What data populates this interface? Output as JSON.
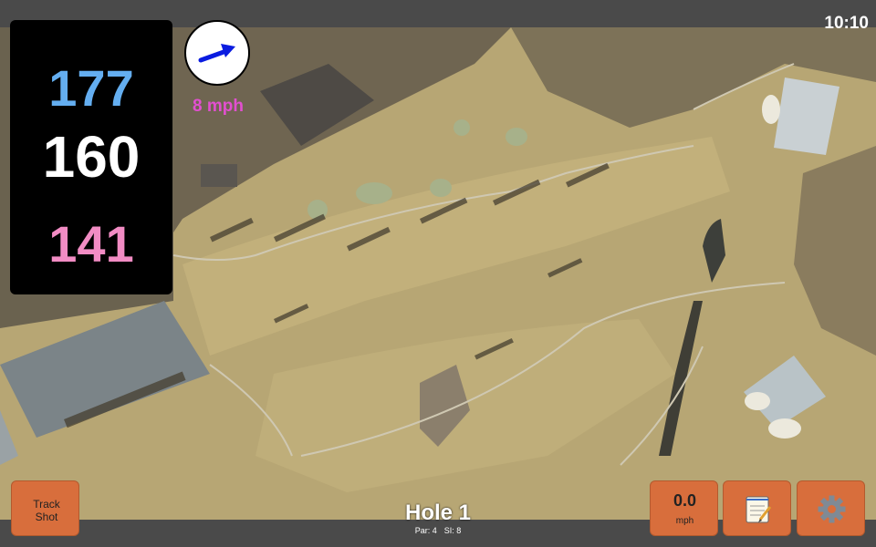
{
  "status": {
    "time": "10:10"
  },
  "yardages": {
    "back": "177",
    "middle": "160",
    "front": "141"
  },
  "wind": {
    "speed": "8 mph",
    "direction_icon": "arrow-up-right-icon"
  },
  "hole": {
    "title": "Hole 1",
    "par": "Par: 4",
    "si": "SI: 8"
  },
  "buttons": {
    "track_shot": "Track Shot",
    "speed_value": "0.0",
    "speed_unit": "mph",
    "notes_icon": "notepad-icon",
    "settings_icon": "gear-icon"
  },
  "colors": {
    "back": "#64aef0",
    "middle": "#ffffff",
    "front": "#f28cc4",
    "wind_text": "#e24fd0",
    "button": "#d86e3c"
  }
}
